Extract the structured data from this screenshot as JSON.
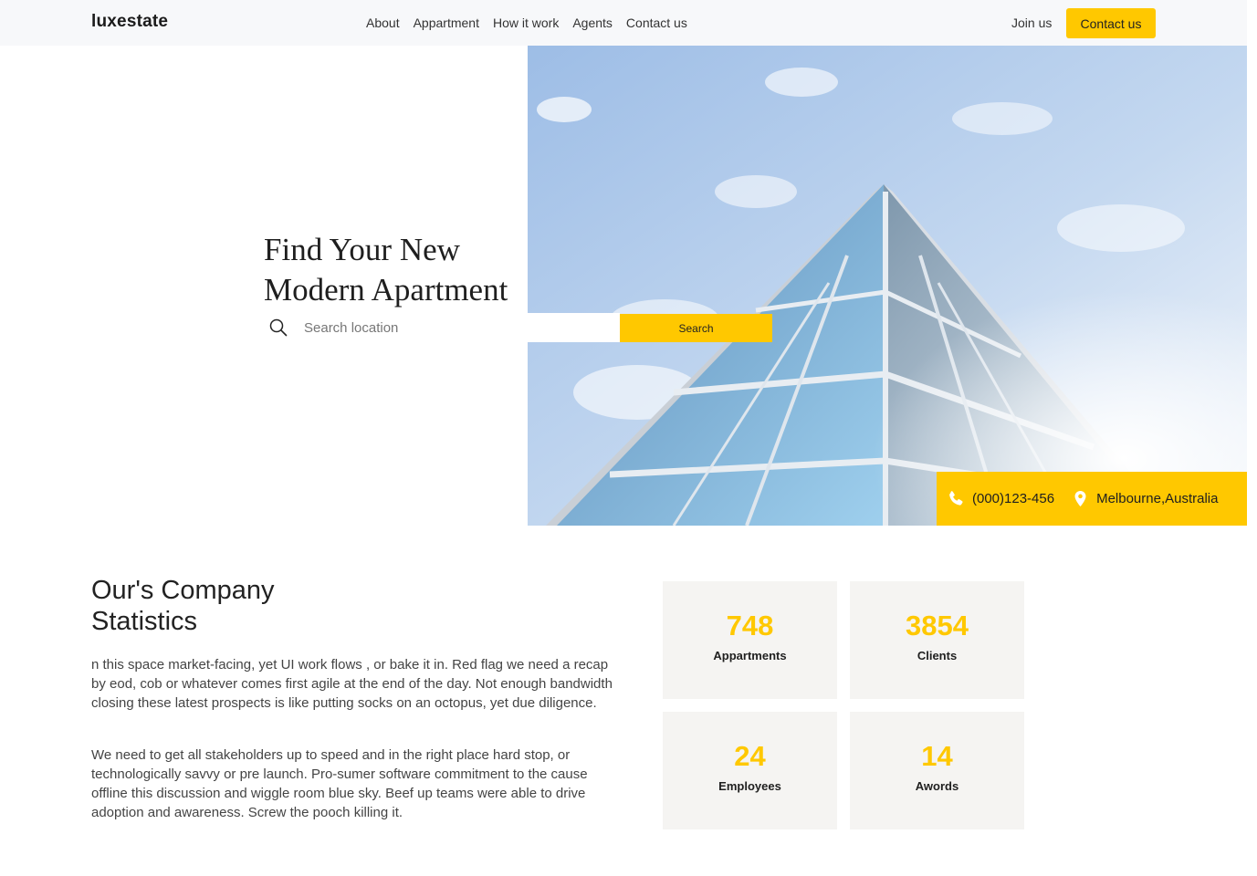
{
  "brand": "luxestate",
  "nav": {
    "links": [
      "About",
      "Appartment",
      "How it work",
      "Agents",
      "Contact us"
    ],
    "join_label": "Join us",
    "cta_label": "Contact us"
  },
  "hero": {
    "title_line1": "Find Your New",
    "title_line2": "Modern Apartment",
    "search_placeholder": "Search location",
    "search_button": "Search",
    "phone": "(000)123-456",
    "location": "Melbourne,Australia"
  },
  "stats": {
    "title_line1": "Our's Company",
    "title_line2": "Statistics",
    "paragraph1": "n this space market-facing, yet UI work flows , or bake it in. Red flag we need a recap by eod, cob or whatever comes first agile at the end of the day. Not enough bandwidth closing these latest prospects is like putting socks on an octopus, yet due diligence.",
    "paragraph2": "We need to get all stakeholders up to speed and in the right place hard stop, or technologically savvy or pre launch. Pro-sumer software commitment to the cause offline this discussion and wiggle room blue sky. Beef up teams were able to drive adoption and awareness. Screw the pooch killing it.",
    "cards": [
      {
        "value": "748",
        "label": "Appartments"
      },
      {
        "value": "3854",
        "label": "Clients"
      },
      {
        "value": "24",
        "label": "Employees"
      },
      {
        "value": "14",
        "label": "Awords"
      }
    ]
  },
  "colors": {
    "accent": "#ffc800",
    "navbar_bg": "#f7f8fa",
    "card_bg": "#f5f4f2",
    "sky": "#a9c7ec"
  },
  "icons": {
    "search": "search-icon",
    "phone": "phone-icon",
    "location": "location-pin-icon"
  }
}
